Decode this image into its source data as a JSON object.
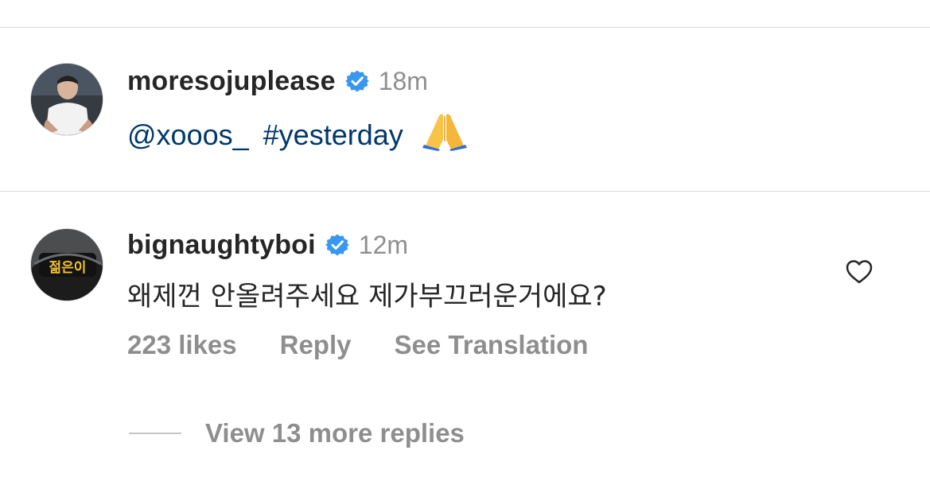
{
  "post_caption": {
    "username": "moresojuplease",
    "verified": true,
    "time": "18m",
    "mention": "@xooos_",
    "hashtag": "#yesterday",
    "emoji": "folded-hands"
  },
  "comment": {
    "username": "bignaughtyboi",
    "verified": true,
    "time": "12m",
    "text": "왜제껀 안올려주세요 제가부끄러운거에요?",
    "likes": "223 likes",
    "reply_label": "Reply",
    "translate_label": "See Translation",
    "avatar_sign_text": "젊은이"
  },
  "view_replies": {
    "label": "View 13 more replies"
  },
  "colors": {
    "link": "#00376b",
    "muted": "#8e8e8e",
    "verified": "#3897f0",
    "text": "#262626"
  }
}
